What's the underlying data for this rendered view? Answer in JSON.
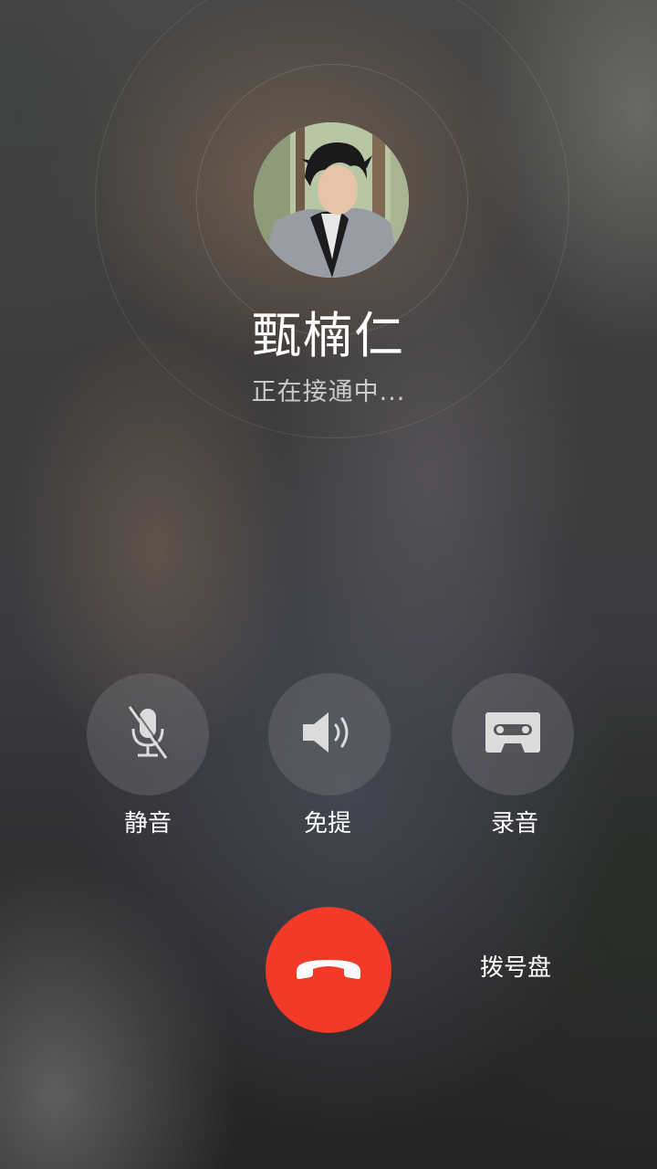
{
  "caller": {
    "name": "甄楠仁",
    "status": "正在接通中..."
  },
  "controls": [
    {
      "label": "静音",
      "icon": "microphone-muted-icon"
    },
    {
      "label": "免提",
      "icon": "speaker-icon"
    },
    {
      "label": "录音",
      "icon": "cassette-record-icon"
    }
  ],
  "hangup": {
    "icon": "phone-hangup-icon",
    "color": "#f23a26"
  },
  "dialpad": {
    "label": "拨号盘"
  }
}
